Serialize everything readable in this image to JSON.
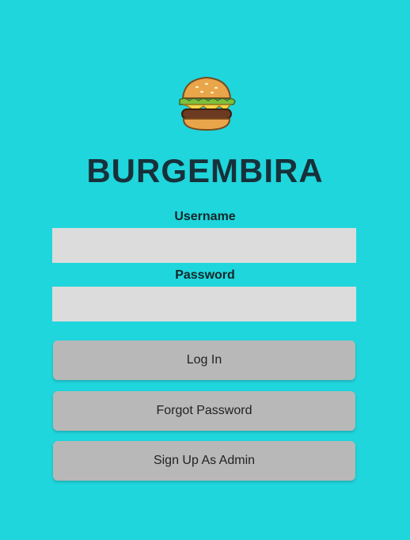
{
  "app": {
    "title": "BURGEMBIRA",
    "logo_icon": "burger-icon"
  },
  "form": {
    "username_label": "Username",
    "username_value": "",
    "password_label": "Password",
    "password_value": ""
  },
  "buttons": {
    "login": "Log In",
    "forgot_password": "Forgot Password",
    "signup_admin": "Sign Up As Admin"
  },
  "colors": {
    "background": "#1fd6dc",
    "input_bg": "#dcdcdc",
    "button_bg": "#b8b8b8",
    "title_text": "#17313a"
  }
}
